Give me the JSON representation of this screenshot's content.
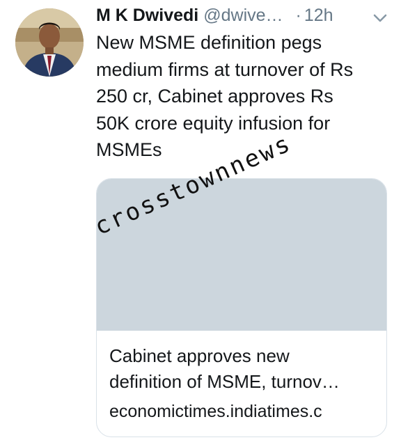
{
  "tweet": {
    "author_name": "M K Dwivedi",
    "handle": "@dwive…",
    "separator": "·",
    "time": "12h",
    "text": "New MSME definition pegs\nmedium firms at turnover of Rs\n250 cr, Cabinet approves Rs\n50K crore equity infusion for\nMSMEs",
    "menu_icon": "chevron-down-icon"
  },
  "card": {
    "title": "Cabinet approves new\ndefinition of MSME, turnov…",
    "domain": "economictimes.indiatimes.c",
    "image_placeholder_color": "#ccd6dd"
  },
  "watermark": {
    "text": "crosstownnews"
  },
  "colors": {
    "text_primary": "#14171a",
    "text_secondary": "#657786",
    "card_border": "#d9e1e8"
  }
}
